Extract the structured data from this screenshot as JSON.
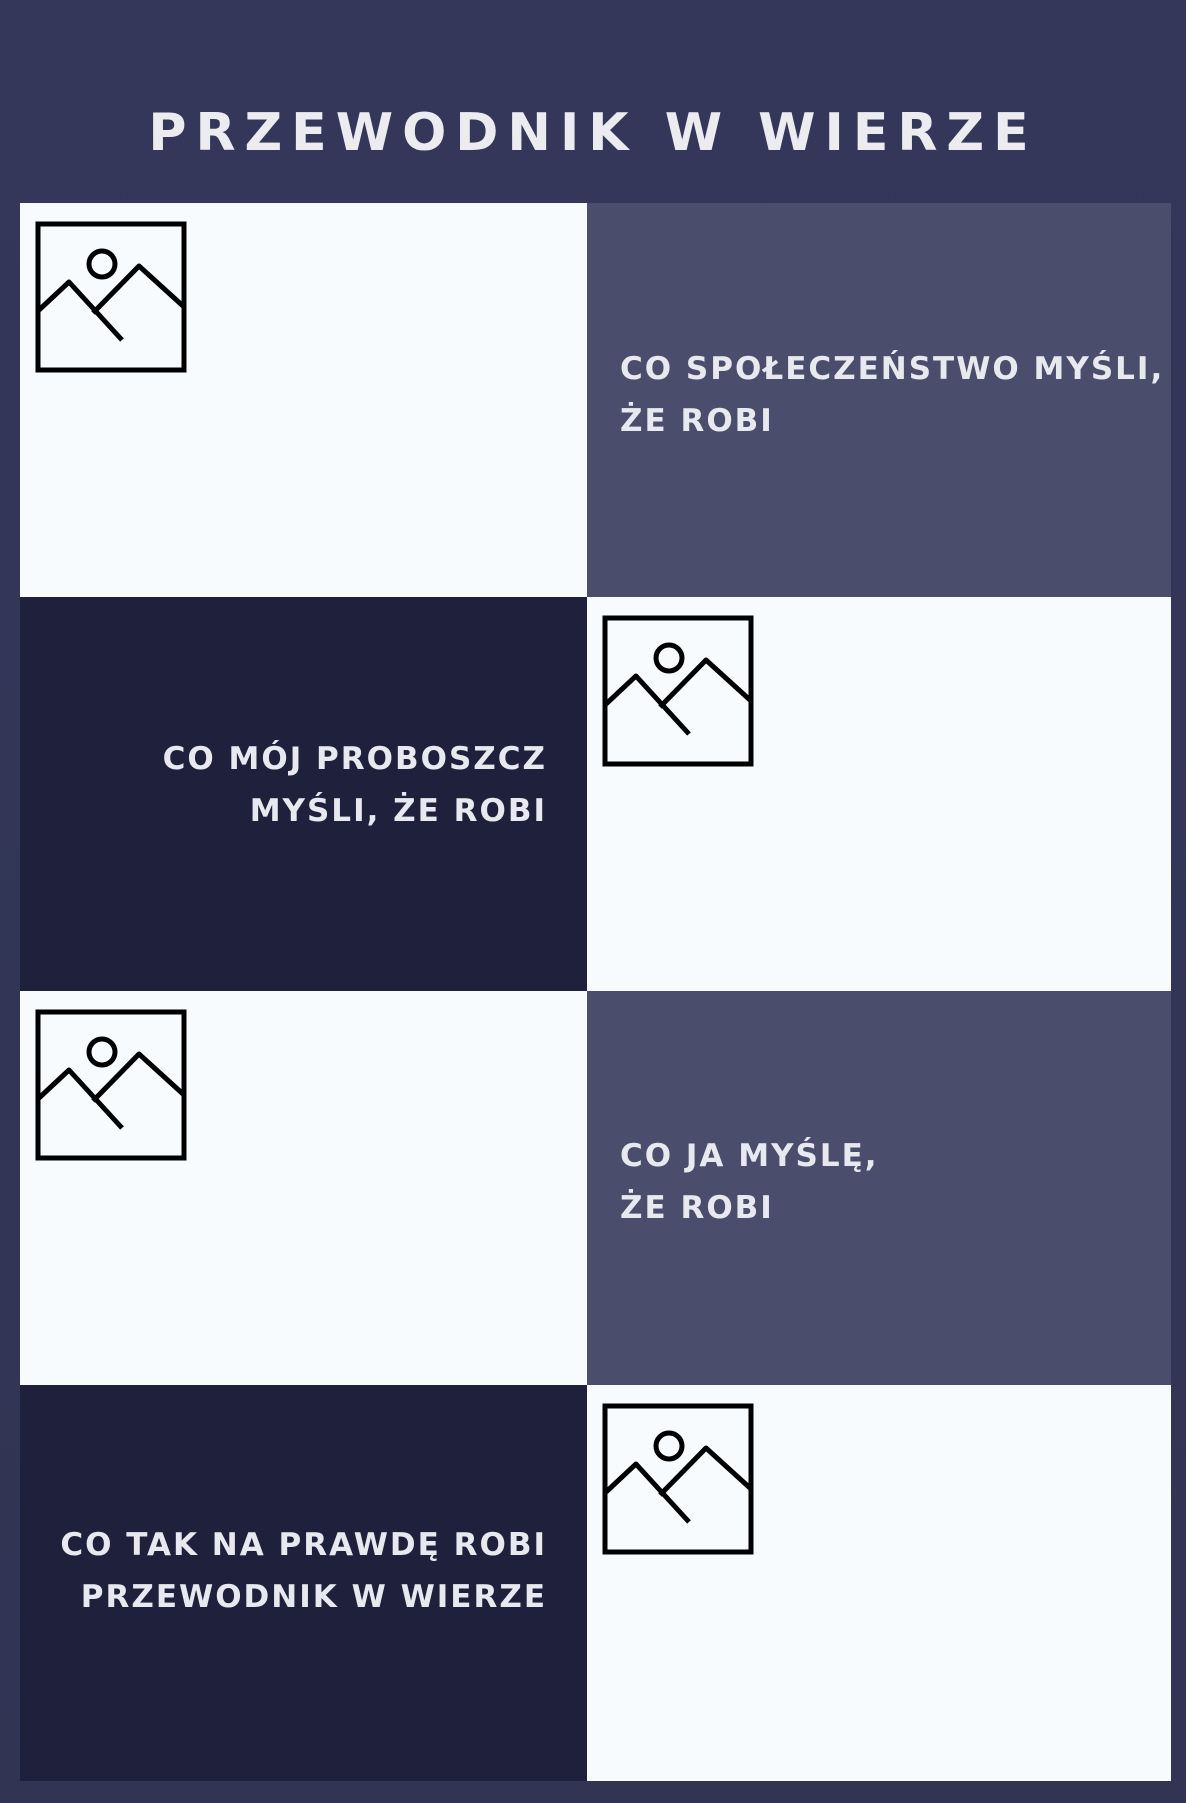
{
  "title": "PRZEWODNIK W WIERZE",
  "colors": {
    "background": "#34375a",
    "light_panel": "#f7fbfe",
    "mid_panel": "#4a4e6c",
    "dark_panel": "#1f213c",
    "text": "#ececf0"
  },
  "panels": [
    {
      "image_icon": "image-placeholder-icon",
      "caption_lines": [
        "CO SPOŁECZEŃSTWO MYŚLI,",
        "ŻE ROBI"
      ]
    },
    {
      "image_icon": "image-placeholder-icon",
      "caption_lines": [
        "CO MÓJ PROBOSZCZ",
        "MYŚLI, ŻE ROBI"
      ]
    },
    {
      "image_icon": "image-placeholder-icon",
      "caption_lines": [
        "CO JA MYŚLĘ,",
        "ŻE ROBI"
      ]
    },
    {
      "image_icon": "image-placeholder-icon",
      "caption_lines": [
        "CO TAK NA PRAWDĘ ROBI",
        "PRZEWODNIK W WIERZE"
      ]
    }
  ]
}
